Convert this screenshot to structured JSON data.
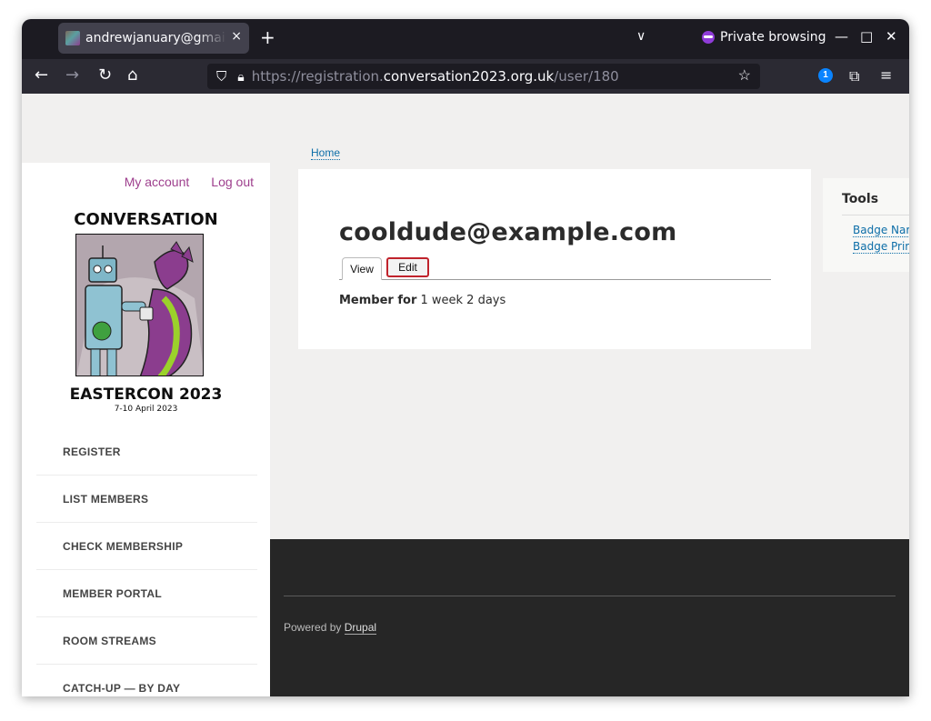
{
  "browser": {
    "tab_title": "andrewjanuary@gmail.com",
    "tab_close": "×",
    "new_tab": "+",
    "tab_list": "∨",
    "private_label": "Private browsing",
    "minimize": "—",
    "maximize": "□",
    "close": "✕",
    "url_prefix": "https://registration.",
    "url_host": "conversation2023.org.uk",
    "url_path": "/user/180"
  },
  "sidebar": {
    "my_account": "My account",
    "log_out": "Log out",
    "logo_title": "CONVERSATION",
    "logo_subtitle": "EASTERCON 2023",
    "logo_dates": "7-10 April 2023",
    "menu": [
      {
        "label": "REGISTER"
      },
      {
        "label": "LIST MEMBERS"
      },
      {
        "label": "CHECK MEMBERSHIP"
      },
      {
        "label": "MEMBER PORTAL"
      },
      {
        "label": "ROOM STREAMS"
      },
      {
        "label": "CATCH-UP — BY DAY"
      }
    ]
  },
  "main": {
    "breadcrumb": "Home",
    "heading": "cooldude@example.com",
    "tab_view": "View",
    "tab_edit": "Edit",
    "member_label": "Member for",
    "member_value": " 1 week 2 days"
  },
  "tools": {
    "title": "Tools",
    "links": [
      {
        "label": "Badge Nar"
      },
      {
        "label": "Badge Prir"
      }
    ]
  },
  "footer": {
    "powered_by": "Powered by ",
    "drupal": "Drupal"
  }
}
